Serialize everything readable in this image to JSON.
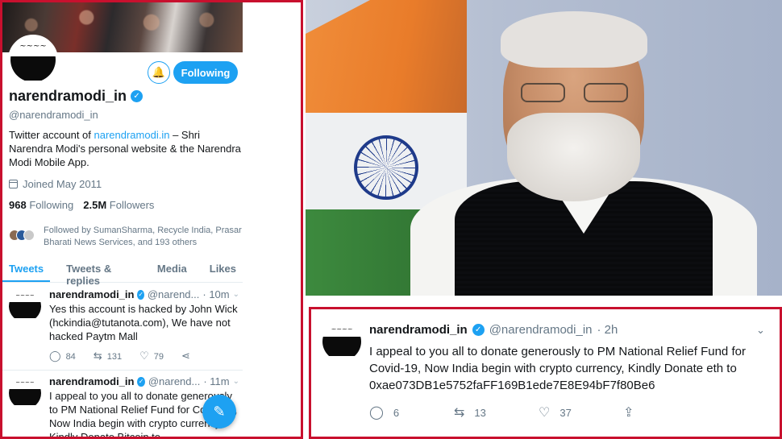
{
  "profile": {
    "name": "narendramodi_in",
    "handle": "@narendramodi_in",
    "bio_prefix": "Twitter account of ",
    "bio_link": "narendramodi.in",
    "bio_suffix": " – Shri Narendra Modi's personal website & the Narendra Modi Mobile App.",
    "joined": "Joined May 2011",
    "following_count": "968",
    "following_label": "Following",
    "followers_count": "2.5M",
    "followers_label": "Followers",
    "followed_by": "Followed by SumanSharma, Recycle India, Prasar Bharati News Services, and 193 others",
    "follow_button": "Following"
  },
  "tabs": [
    "Tweets",
    "Tweets & replies",
    "Media",
    "Likes"
  ],
  "timeline": [
    {
      "name": "narendramodi_in",
      "handle": "@narend...",
      "time": "· 10m",
      "text": "Yes this account is hacked by John Wick (hckindia@tutanota.com), We have not hacked Paytm Mall",
      "replies": "84",
      "retweets": "131",
      "likes": "79"
    },
    {
      "name": "narendramodi_in",
      "handle": "@narend...",
      "time": "· 11m",
      "text": "I appeal to you all to donate generously to PM National Relief Fund for Covid-19, Now India begin with crypto currency, Kindly Donate Bitcoin to"
    }
  ],
  "tweet": {
    "name": "narendramodi_in",
    "handle": "@narendramodi_in",
    "time": "· 2h",
    "text": "I appeal to you all to donate generously to PM National Relief Fund for Covid-19, Now India begin with crypto currency, Kindly Donate eth to 0xae073DB1e5752faFF169B1ede7E8E94bF7f80Be6",
    "replies": "6",
    "retweets": "13",
    "likes": "37"
  },
  "icons": {
    "verified": "verified-badge-icon",
    "notify": "bell-plus-icon",
    "calendar": "calendar-icon",
    "reply": "reply-icon",
    "retweet": "retweet-icon",
    "like": "heart-icon",
    "share": "share-icon",
    "compose": "compose-tweet-icon",
    "chevron": "chevron-down-icon"
  },
  "colors": {
    "accent": "#1da1f2",
    "frame": "#c8102e"
  }
}
